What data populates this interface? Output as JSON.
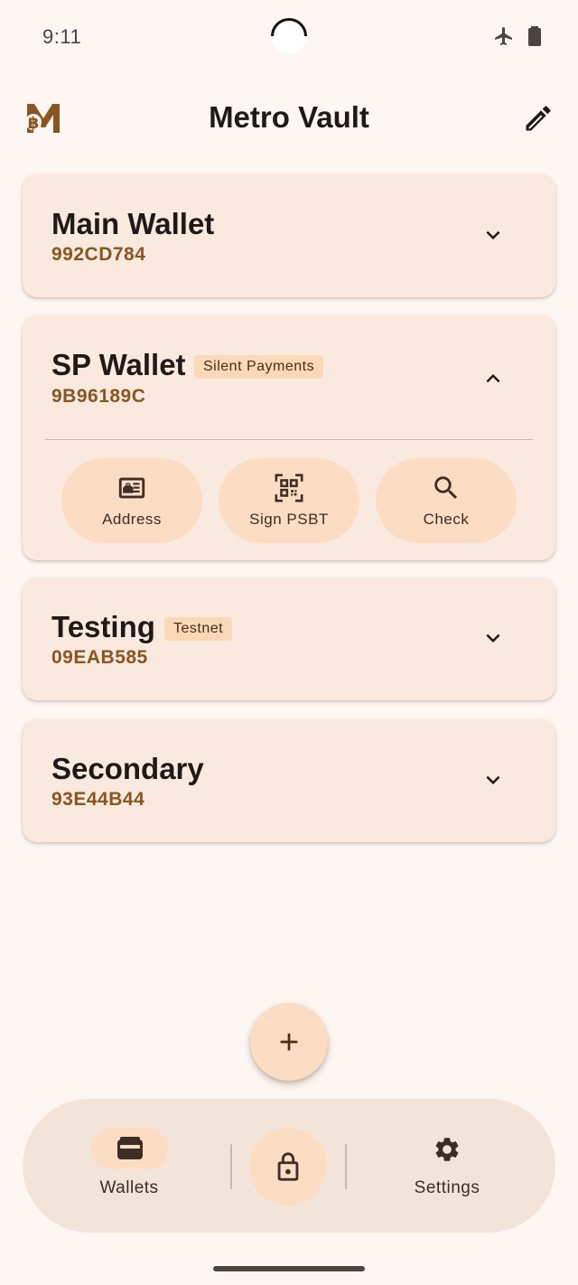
{
  "status": {
    "time": "9:11"
  },
  "app": {
    "title": "Metro Vault"
  },
  "wallets": [
    {
      "name": "Main Wallet",
      "fingerprint": "992CD784",
      "badge": "",
      "expanded": false
    },
    {
      "name": "SP Wallet",
      "fingerprint": "9B96189C",
      "badge": "Silent Payments",
      "expanded": true,
      "actions": [
        {
          "label": "Address",
          "icon": "contact-card-icon"
        },
        {
          "label": "Sign PSBT",
          "icon": "qr-scan-icon"
        },
        {
          "label": "Check",
          "icon": "search-icon"
        }
      ]
    },
    {
      "name": "Testing",
      "fingerprint": "09EAB585",
      "badge": "Testnet",
      "expanded": false
    },
    {
      "name": "Secondary",
      "fingerprint": "93E44B44",
      "badge": "",
      "expanded": false
    }
  ],
  "nav": {
    "wallets_label": "Wallets",
    "settings_label": "Settings"
  },
  "colors": {
    "background": "#fdf6f2",
    "card": "#f9e9df",
    "accent": "#fcdcc2",
    "fingerprint": "#8a5520"
  }
}
